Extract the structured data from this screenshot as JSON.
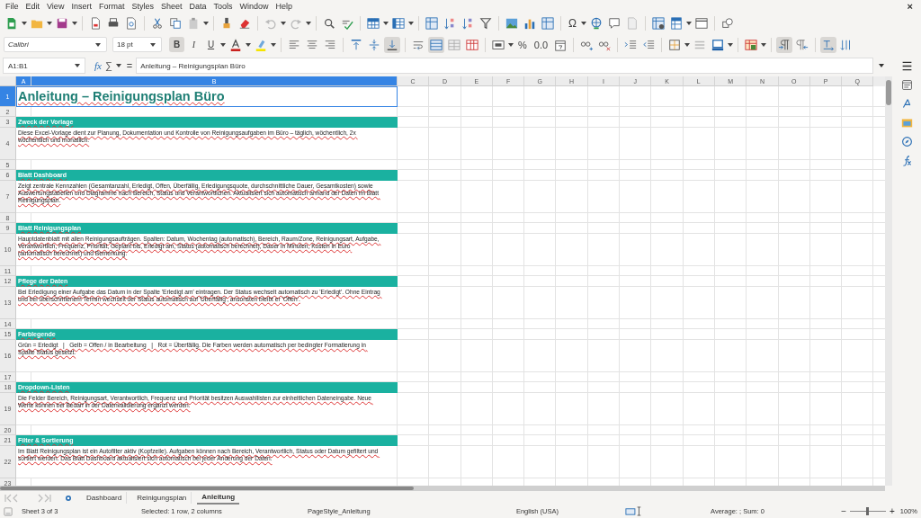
{
  "menu": [
    "File",
    "Edit",
    "View",
    "Insert",
    "Format",
    "Styles",
    "Sheet",
    "Data",
    "Tools",
    "Window",
    "Help"
  ],
  "close_glyph": "×",
  "special_char": "Ω",
  "format_bar": {
    "font_name": "Calibri",
    "font_size": "18 pt"
  },
  "style_buttons": [
    {
      "label": "B",
      "selected": true
    },
    {
      "label": "I",
      "selected": false
    },
    {
      "label": "U",
      "selected": false
    }
  ],
  "number_buttons": [
    "%",
    "0.0"
  ],
  "toggles": {
    "align_top": false,
    "align_center": false,
    "align_bottom": true,
    "wrap_text": false,
    "merge_center": true,
    "left_to_right": true,
    "right_to_left": false,
    "text_ltr": true,
    "text_ttb": false
  },
  "formula_bar": {
    "name_box": "A1:B1",
    "function_glyph": "fx",
    "sum_glyph": "∑",
    "equals_glyph": "=",
    "content": "Anleitung – Reinigungsplan Büro"
  },
  "columns": [
    {
      "label": "A",
      "selected": true
    },
    {
      "label": "B",
      "selected": true
    },
    {
      "label": "C",
      "selected": false
    },
    {
      "label": "D",
      "selected": false
    },
    {
      "label": "E",
      "selected": false
    },
    {
      "label": "F",
      "selected": false
    },
    {
      "label": "G",
      "selected": false
    },
    {
      "label": "H",
      "selected": false
    },
    {
      "label": "I",
      "selected": false
    },
    {
      "label": "J",
      "selected": false
    },
    {
      "label": "K",
      "selected": false
    },
    {
      "label": "L",
      "selected": false
    },
    {
      "label": "M",
      "selected": false
    },
    {
      "label": "N",
      "selected": false
    },
    {
      "label": "O",
      "selected": false
    },
    {
      "label": "P",
      "selected": false
    },
    {
      "label": "Q",
      "selected": false
    }
  ],
  "autospell": true,
  "rows": [
    {
      "number": "1",
      "selected": true,
      "kind": "title",
      "text": "Anleitung – Reinigungsplan Büro"
    },
    {
      "number": "2",
      "selected": false,
      "kind": "blank"
    },
    {
      "number": "3",
      "selected": false,
      "kind": "heading",
      "text": "Zweck der Vorlage"
    },
    {
      "number": "4",
      "selected": false,
      "kind": "text",
      "text": "Diese Excel-Vorlage dient zur Planung, Dokumentation und Kontrolle von Reinigungsaufgaben im Büro – täglich, wöchentlich, 2x wöchentlich und monatlich."
    },
    {
      "number": "5",
      "selected": false,
      "kind": "blank"
    },
    {
      "number": "6",
      "selected": false,
      "kind": "heading",
      "text": "Blatt Dashboard"
    },
    {
      "number": "7",
      "selected": false,
      "kind": "text",
      "text": "Zeigt zentrale Kennzahlen (Gesamtanzahl, Erledigt, Offen, Überfällig, Erledigungsquote, durchschnittliche Dauer, Gesamtkosten) sowie Auswertungstabellen und Diagramme nach Bereich, Status und Verantwortlichen. Aktualisiert sich automatisch anhand der Daten im Blatt Reinigungsplan."
    },
    {
      "number": "8",
      "selected": false,
      "kind": "blank"
    },
    {
      "number": "9",
      "selected": false,
      "kind": "heading",
      "text": "Blatt Reinigungsplan"
    },
    {
      "number": "10",
      "selected": false,
      "kind": "text",
      "text": "Hauptdatenblatt mit allen Reinigungsaufträgen. Spalten: Datum, Wochentag (automatisch), Bereich, Raum/Zone, Reinigungsart, Aufgabe, Verantwortlich, Frequenz, Priorität, Geplant bis, Erledigt am, Status (automatisch berechnet), Dauer in Minuten, Kosten in Euro (automatisch berechnet) und Bemerkung."
    },
    {
      "number": "11",
      "selected": false,
      "kind": "blank"
    },
    {
      "number": "12",
      "selected": false,
      "kind": "heading",
      "text": "Pflege der Daten"
    },
    {
      "number": "13",
      "selected": false,
      "kind": "text",
      "text": "Bei Erledigung einer Aufgabe das Datum in der Spalte 'Erledigt am' eintragen. Der Status wechselt automatisch zu 'Erledigt'. Ohne Eintrag und bei überschrittenem Termin wechselt der Status automatisch auf 'Überfällig', ansonsten bleibt er 'Offen'."
    },
    {
      "number": "14",
      "selected": false,
      "kind": "blank"
    },
    {
      "number": "15",
      "selected": false,
      "kind": "heading",
      "text": "Farblegende"
    },
    {
      "number": "16",
      "selected": false,
      "kind": "text",
      "text": "Grün = Erledigt   |   Gelb = Offen / in Bearbeitung   |   Rot = Überfällig. Die Farben werden automatisch per bedingter Formatierung in Spalte Status gesetzt."
    },
    {
      "number": "17",
      "selected": false,
      "kind": "blank"
    },
    {
      "number": "18",
      "selected": false,
      "kind": "heading",
      "text": "Dropdown-Listen"
    },
    {
      "number": "19",
      "selected": false,
      "kind": "text",
      "text": "Die Felder Bereich, Reinigungsart, Verantwortlich, Frequenz und Priorität besitzen Auswahllisten zur einheitlichen Dateneingabe. Neue Werte können bei Bedarf in der Datenvalidierung ergänzt werden."
    },
    {
      "number": "20",
      "selected": false,
      "kind": "blank"
    },
    {
      "number": "21",
      "selected": false,
      "kind": "heading",
      "text": "Filter & Sortierung"
    },
    {
      "number": "22",
      "selected": false,
      "kind": "text",
      "text": "Im Blatt Reinigungsplan ist ein Autofilter aktiv (Kopfzeile). Aufgaben können nach Bereich, Verantwortlich, Status oder Datum gefiltert und sortiert werden. Das Blatt Dashboard aktualisiert sich automatisch bei jeder Änderung der Daten."
    },
    {
      "number": "23",
      "selected": false,
      "kind": "blank"
    }
  ],
  "sheet_tabs": [
    {
      "label": "Dashboard",
      "selected": false
    },
    {
      "label": "Reinigungsplan",
      "selected": false
    },
    {
      "label": "Anleitung",
      "selected": true
    }
  ],
  "status_bar": {
    "sheet": "Sheet 3 of 3",
    "selection": "Selected: 1 row, 2 columns",
    "page_style": "PageStyle_Anleitung",
    "language": "English (USA)",
    "sum": "Average: ; Sum: 0",
    "zoom_minus": "−",
    "zoom_plus": "+",
    "zoom": "100%"
  },
  "zoom_slider": {
    "level": 0.5
  }
}
